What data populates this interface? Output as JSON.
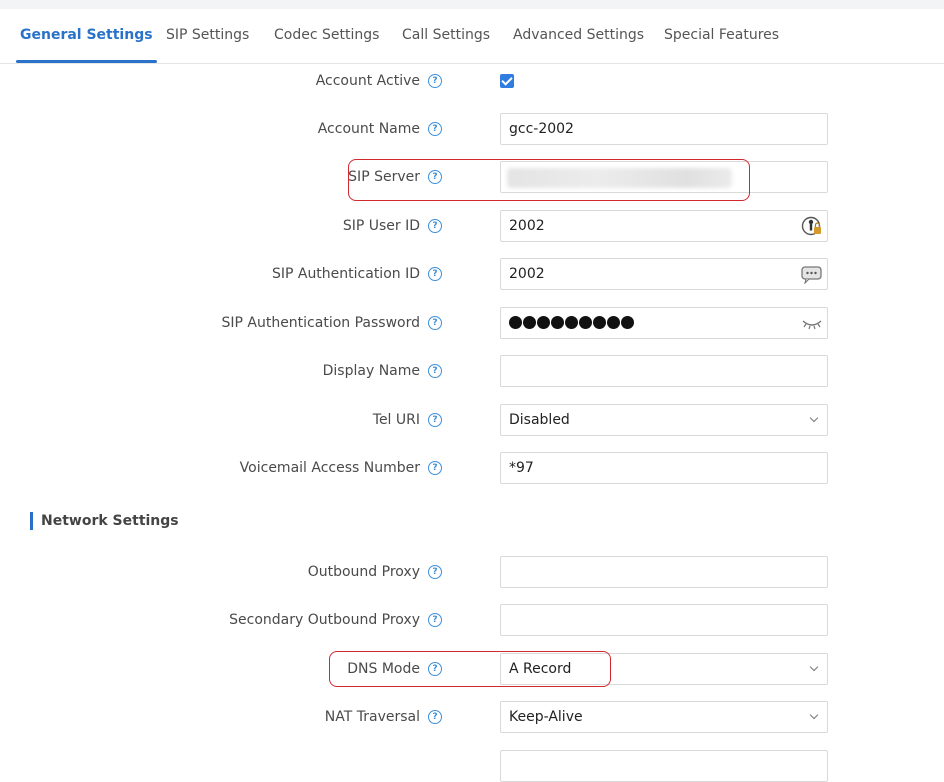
{
  "tabs": [
    {
      "label": "General Settings"
    },
    {
      "label": "SIP Settings"
    },
    {
      "label": "Codec Settings"
    },
    {
      "label": "Call Settings"
    },
    {
      "label": "Advanced Settings"
    },
    {
      "label": "Special Features"
    }
  ],
  "general": {
    "account_active": {
      "label": "Account Active",
      "checked": true
    },
    "account_name": {
      "label": "Account Name",
      "value": "gcc-2002"
    },
    "sip_server": {
      "label": "SIP Server",
      "value": ""
    },
    "sip_user_id": {
      "label": "SIP User ID",
      "value": "2002"
    },
    "sip_auth_id": {
      "label": "SIP Authentication ID",
      "value": "2002"
    },
    "sip_auth_password": {
      "label": "SIP Authentication Password",
      "masked_length": 9
    },
    "display_name": {
      "label": "Display Name",
      "value": ""
    },
    "tel_uri": {
      "label": "Tel URI",
      "value": "Disabled"
    },
    "voicemail": {
      "label": "Voicemail Access Number",
      "value": "*97"
    }
  },
  "network": {
    "title": "Network Settings",
    "outbound_proxy": {
      "label": "Outbound Proxy",
      "value": ""
    },
    "secondary_outbound_proxy": {
      "label": "Secondary Outbound Proxy",
      "value": ""
    },
    "dns_mode": {
      "label": "DNS Mode",
      "value": "A Record"
    },
    "nat_traversal": {
      "label": "NAT Traversal",
      "value": "Keep-Alive"
    }
  },
  "help_glyph": "?",
  "colors": {
    "accent": "#2a72c9",
    "highlight": "#d3282d"
  }
}
